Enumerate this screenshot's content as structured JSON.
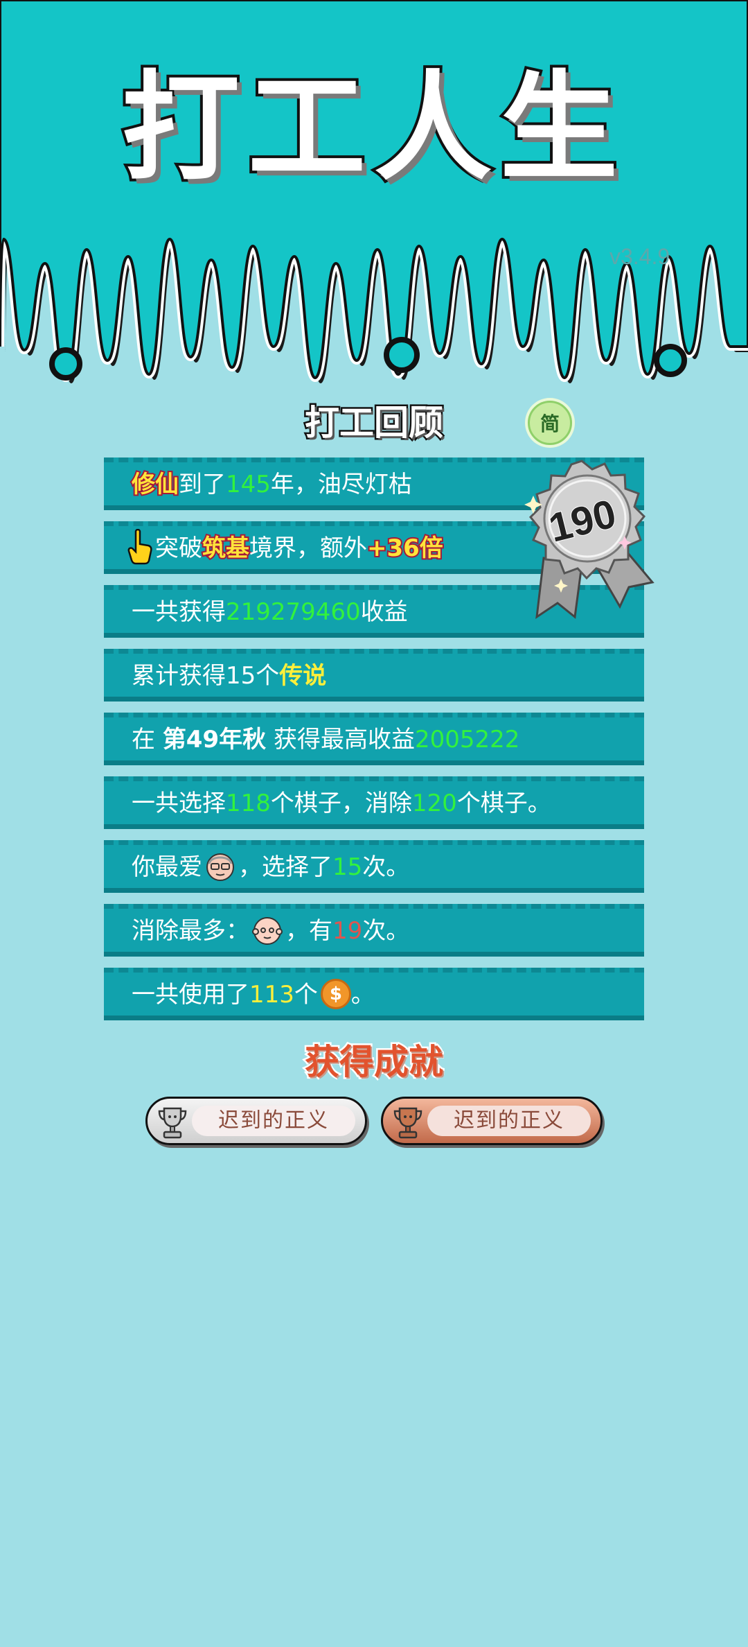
{
  "app": {
    "title": "打工人生",
    "version": "v3.4.9"
  },
  "review": {
    "title": "打工回顾",
    "lang_button": "简",
    "badge_number": "190",
    "rows": [
      {
        "p1": "修仙",
        "p2": "到了",
        "p3": "145",
        "p4": "年，油尽灯枯"
      },
      {
        "p1": "突破",
        "p2": "筑基",
        "p3": "境界，额外",
        "p4": "+36倍"
      },
      {
        "p1": "一共获得",
        "p2": "219279460",
        "p3": "收益"
      },
      {
        "p1": "累计获得",
        "p2": "15",
        "p3": "个",
        "p4": "传说"
      },
      {
        "p1": "在 ",
        "p2": "第49年秋",
        "p3": " 获得最高收益",
        "p4": "2005222"
      },
      {
        "p1": "一共选择",
        "p2": "118",
        "p3": "个棋子，消除",
        "p4": "120",
        "p5": "个棋子。"
      },
      {
        "p1": "你最爱",
        "p2": "，选择了",
        "p3": "15",
        "p4": "次。"
      },
      {
        "p1": "消除最多：",
        "p2": "，有",
        "p3": "19",
        "p4": "次。"
      },
      {
        "p1": "一共使用了",
        "p2": "113",
        "p3": "个",
        "p4": "。"
      }
    ]
  },
  "achievements": {
    "title": "获得成就",
    "items": [
      {
        "label": "迟到的正义",
        "tier": "silver"
      },
      {
        "label": "迟到的正义",
        "tier": "bronze"
      }
    ]
  },
  "colors": {
    "header_bg": "#14c5c7",
    "page_bg": "#a0dfe6",
    "row_bg": "#11a2ad",
    "highlight_green": "#32f23d",
    "highlight_yellow": "#ffef3a",
    "highlight_red": "#e0554f",
    "achievement_title": "#e2532e"
  },
  "icons": {
    "pointing_hand": "hand-pointer-icon",
    "glasses_face": "old-man-glasses-face-icon",
    "bald_face": "bald-man-face-icon",
    "coin": "dollar-coin-icon",
    "trophy": "trophy-icon",
    "rosette": "rosette-badge-icon"
  }
}
